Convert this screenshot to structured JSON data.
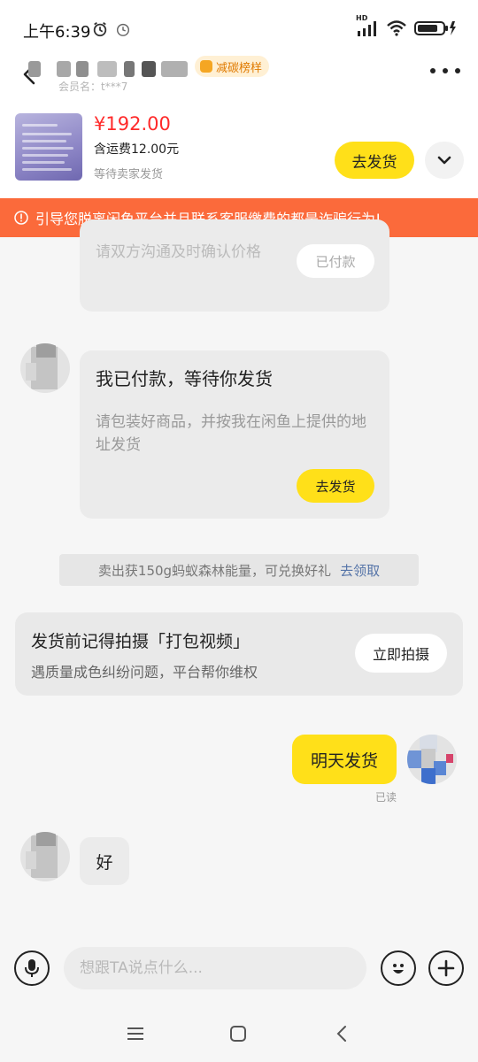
{
  "status_bar": {
    "time": "上午6:39",
    "network_label": "HD",
    "battery_icon": "battery-charging-icon"
  },
  "header": {
    "seller_name": "",
    "rank_badge": "减碳榜样",
    "member_line": "会员名：t***7"
  },
  "order": {
    "price": "¥192.00",
    "shipping_fee": "含运费12.00元",
    "status": "等待卖家发货",
    "ship_button": "去发货"
  },
  "warning": {
    "text": "引导您脱离闲鱼平台并且联系客服缴费的都是诈骗行为!"
  },
  "messages": {
    "partial_card": {
      "text": "请双方沟通及时确认价格",
      "button": "已付款"
    },
    "paid_card": {
      "title": "我已付款，等待你发货",
      "description": "请包装好商品，并按我在闲鱼上提供的地址发货",
      "button": "去发货"
    },
    "energy_notice": {
      "text": "卖出获150g蚂蚁森林能量，可兑换好礼",
      "link": "去领取"
    },
    "video_card": {
      "title": "发货前记得拍摄「打包视频」",
      "subtitle": "遇质量成色纠纷问题，平台帮你维权",
      "button": "立即拍摄"
    },
    "my_message": "明天发货",
    "read_status": "已读",
    "their_message": "好"
  },
  "input_bar": {
    "placeholder": "想跟TA说点什么..."
  },
  "colors": {
    "accent_yellow": "#ffe019",
    "price_red": "#ff2a2a",
    "warning_orange": "#fb6a3b",
    "link_blue": "#5574a8"
  }
}
